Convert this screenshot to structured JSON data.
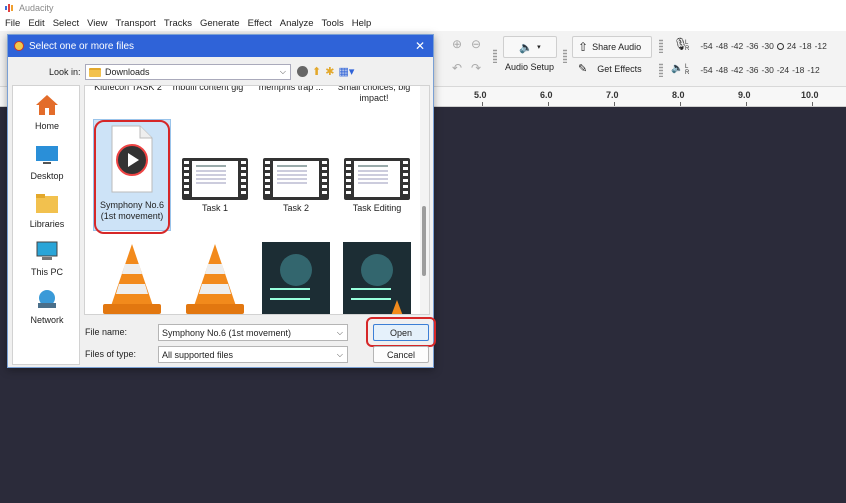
{
  "app": {
    "title": "Audacity",
    "menu": [
      "File",
      "Edit",
      "Select",
      "View",
      "Transport",
      "Tracks",
      "Generate",
      "Effect",
      "Analyze",
      "Tools",
      "Help"
    ]
  },
  "toolbar": {
    "audio_setup_label": "Audio Setup",
    "share_audio_label": "Share Audio",
    "get_effects_label": "Get Effects",
    "meter_scale": [
      "-54",
      "-48",
      "-42",
      "-36",
      "-30",
      "-24",
      "-18",
      "-12"
    ],
    "meter_scale_record": [
      "-54",
      "-48",
      "-42",
      "-36",
      "-30",
      "24",
      "-18",
      "-12"
    ],
    "meter_l": "L",
    "meter_r": "R"
  },
  "ruler": {
    "ticks": [
      "5.0",
      "6.0",
      "7.0",
      "8.0",
      "9.0",
      "10.0"
    ]
  },
  "dialog": {
    "title": "Select one or more files",
    "close": "✕",
    "look_in_label": "Look in:",
    "look_in_value": "Downloads",
    "places": [
      "Home",
      "Desktop",
      "Libraries",
      "This PC",
      "Network"
    ],
    "cut_labels": [
      "Kiufecon TASK 2",
      "mbulfi content gig",
      "memphis trap ...",
      "Small choices, big impact!"
    ],
    "files": [
      {
        "name": "Symphony No.6 (1st movement)",
        "kind": "audio",
        "selected": true
      },
      {
        "name": "Task 1",
        "kind": "video"
      },
      {
        "name": "Task 2",
        "kind": "video"
      },
      {
        "name": "Task Editing",
        "kind": "video"
      },
      {
        "name": "",
        "kind": "vlc"
      },
      {
        "name": "",
        "kind": "vlc"
      },
      {
        "name": "",
        "kind": "image"
      },
      {
        "name": "",
        "kind": "image"
      }
    ],
    "file_name_label": "File name:",
    "file_name_value": "Symphony No.6 (1st movement)",
    "file_type_label": "Files of type:",
    "file_type_value": "All supported files",
    "open_label": "Open",
    "cancel_label": "Cancel"
  },
  "colors": {
    "dialog_title_bg": "#2f63d8",
    "track_bg": "#2b2b3a",
    "highlight": "#d62728",
    "selection": "#cde3f7"
  }
}
